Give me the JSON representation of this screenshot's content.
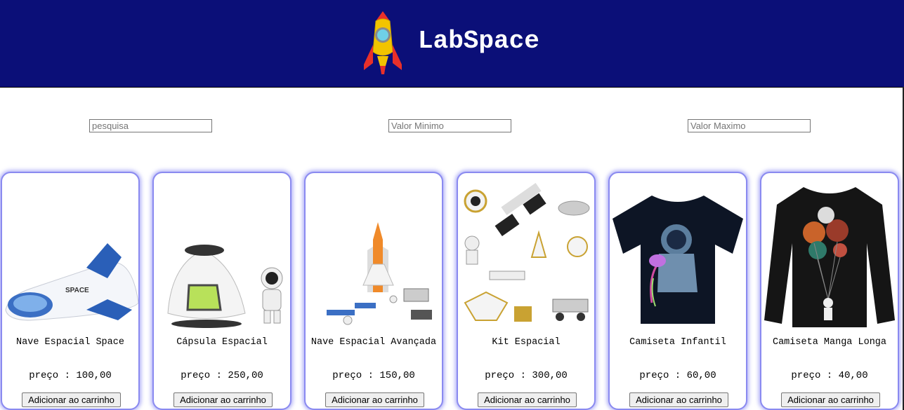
{
  "header": {
    "brand": "LabSpace",
    "logo_icon": "rocket-icon",
    "background": "#0b0f78"
  },
  "filters": {
    "search_placeholder": "pesquisa",
    "min_placeholder": "Valor Minimo",
    "max_placeholder": "Valor Maximo"
  },
  "products": [
    {
      "name": "Nave Espacial Space",
      "price": "preço : 100,00",
      "button": "Adicionar ao carrinho",
      "image": "space-shuttle-toy-image"
    },
    {
      "name": "Cápsula Espacial",
      "price": "preço : 250,00",
      "button": "Adicionar ao carrinho",
      "image": "space-capsule-toy-image"
    },
    {
      "name": "Nave Espacial Avançada",
      "price": "preço : 150,00",
      "button": "Adicionar ao carrinho",
      "image": "advanced-rocket-toy-image"
    },
    {
      "name": "Kit Espacial",
      "price": "preço : 300,00",
      "button": "Adicionar ao carrinho",
      "image": "space-kit-image"
    },
    {
      "name": "Camiseta Infantil",
      "price": "preço : 60,00",
      "button": "Adicionar ao carrinho",
      "image": "astronaut-tshirt-image"
    },
    {
      "name": "Camiseta Manga Longa",
      "price": "preço : 40,00",
      "button": "Adicionar ao carrinho",
      "image": "long-sleeve-shirt-image"
    }
  ]
}
